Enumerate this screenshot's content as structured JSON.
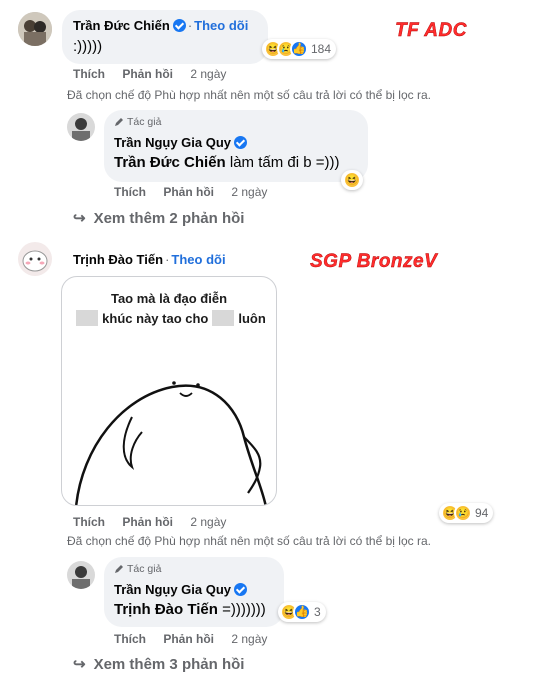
{
  "comments": [
    {
      "author": "Trần Đức Chiến",
      "follow_label": "Theo dõi",
      "text": ":)))))",
      "reactions": {
        "icons": [
          "haha-icon",
          "sad-icon",
          "like-icon"
        ],
        "count": "184"
      },
      "actions": {
        "like": "Thích",
        "reply": "Phản hồi",
        "time": "2 ngày"
      },
      "annotation": "TF ADC",
      "filter_note": "Đã chọn chế độ Phù hợp nhất nên một số câu trả lời có thể bị lọc ra.",
      "reply": {
        "author_badge": "Tác giả",
        "author": "Trần Ngụy Gia Quy",
        "mention": "Trần Đức Chiến",
        "text": " làm tấm đi b =)))",
        "reactions": {
          "icons": [
            "haha-icon"
          ],
          "count": ""
        },
        "actions": {
          "like": "Thích",
          "reply": "Phản hồi",
          "time": "2 ngày"
        }
      },
      "more_replies": "Xem thêm 2 phản hồi"
    },
    {
      "author": "Trịnh Đào Tiến",
      "follow_label": "Theo dõi",
      "annotation": "SGP BronzeV",
      "meme": {
        "line1": "Tao mà là đạo điễn",
        "line2_middle": "khúc này tao cho",
        "line2_end": "luôn"
      },
      "reactions": {
        "icons": [
          "haha-icon",
          "sad-icon"
        ],
        "count": "94"
      },
      "actions": {
        "like": "Thích",
        "reply": "Phản hồi",
        "time": "2 ngày"
      },
      "filter_note": "Đã chọn chế độ Phù hợp nhất nên một số câu trả lời có thể bị lọc ra.",
      "reply": {
        "author_badge": "Tác giả",
        "author": "Trần Ngụy Gia Quy",
        "mention": "Trịnh Đào Tiến",
        "text": " =)))))))",
        "reactions": {
          "icons": [
            "haha-icon",
            "like-icon"
          ],
          "count": "3"
        },
        "actions": {
          "like": "Thích",
          "reply": "Phản hồi",
          "time": "2 ngày"
        }
      },
      "more_replies": "Xem thêm 3 phản hồi"
    }
  ],
  "colors": {
    "link_blue": "#216fdb",
    "annotation_red": "#ff2d2d",
    "secondary_text": "#65676b",
    "bubble_bg": "#f0f2f5"
  }
}
